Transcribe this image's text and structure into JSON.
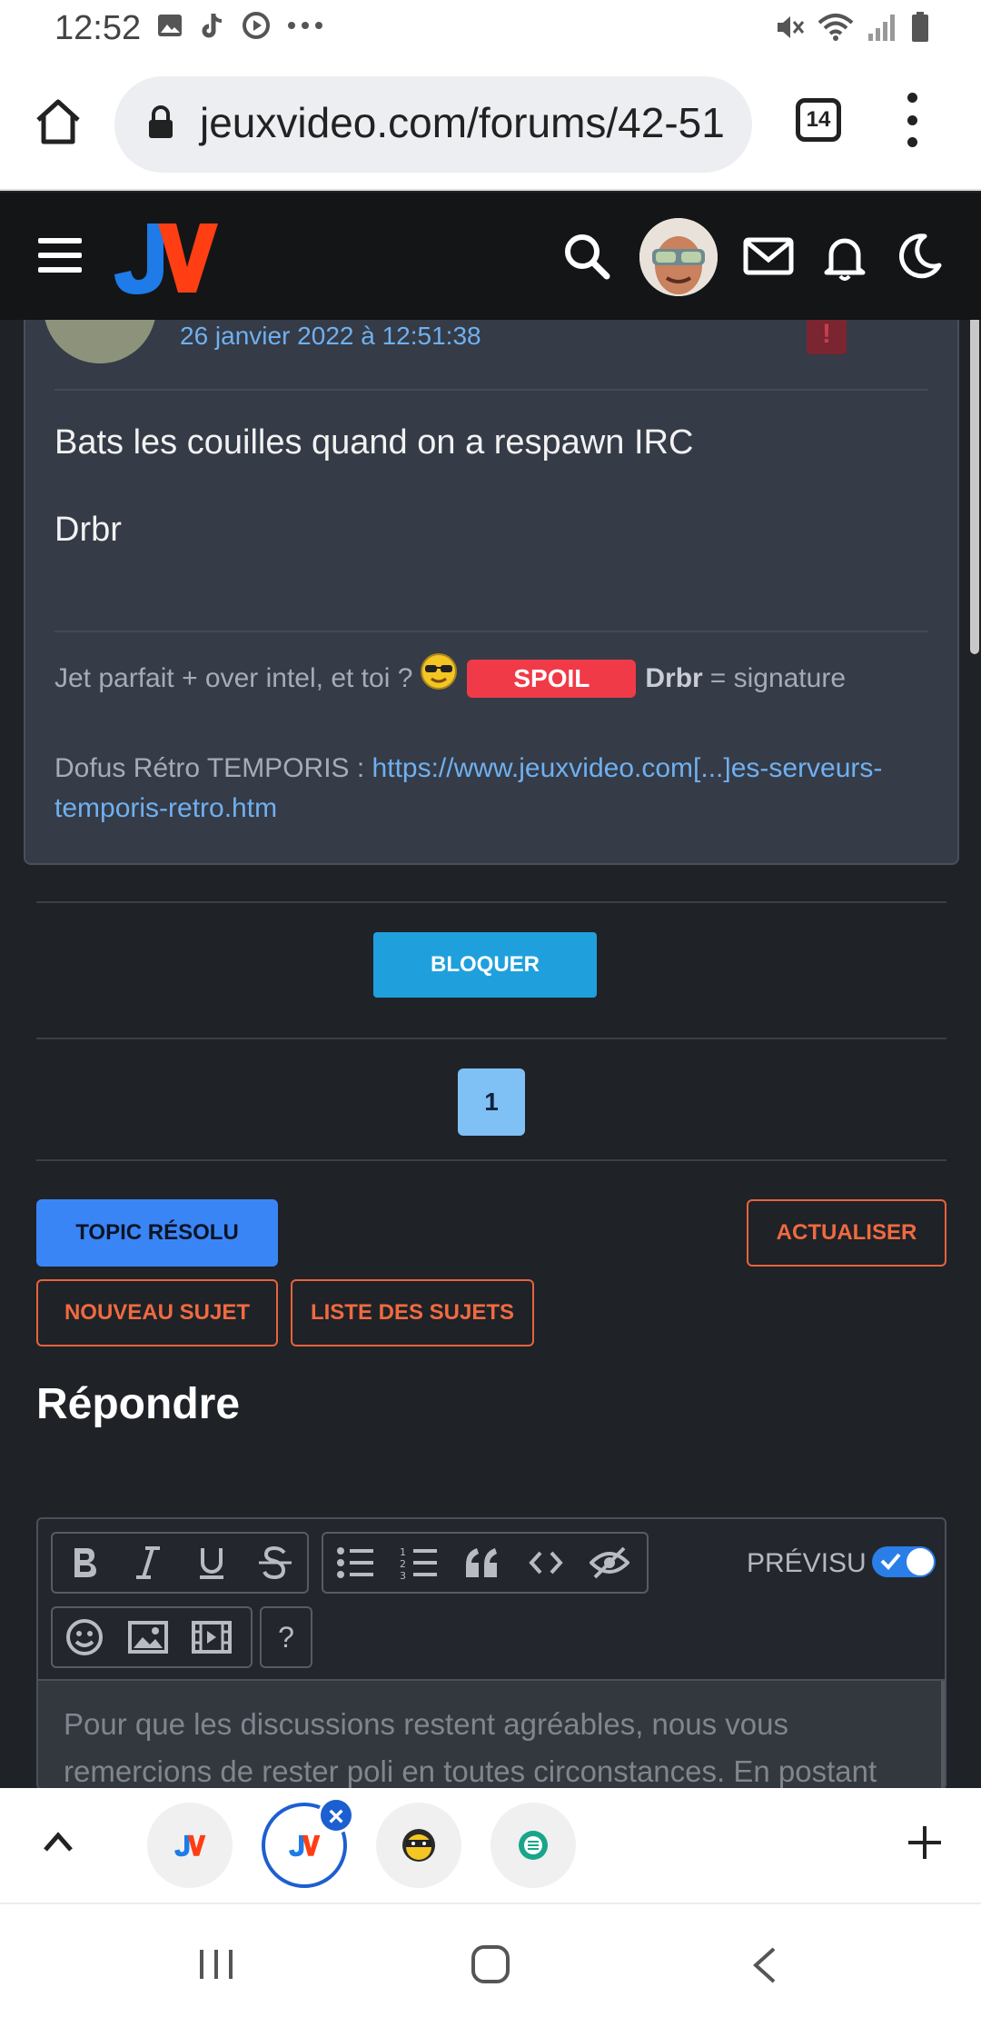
{
  "status_bar": {
    "time": "12:52"
  },
  "browser": {
    "url": "jeuxvideo.com/forums/42-51",
    "tab_count": "14"
  },
  "post": {
    "date": "26 janvier 2022 à 12:51:38",
    "alert_label": "!",
    "message_line1": "Bats les couilles quand on a respawn IRC",
    "message_line2": "Drbr",
    "signature": {
      "prefix": "Jet parfait + over intel, et toi ?",
      "spoil": "SPOIL",
      "bold": "Drbr",
      "suffix": "= signature",
      "line2_text": "Dofus Rétro TEMPORIS : ",
      "line2_link": "https://www.jeuxvideo.com[...]es-serveurs-temporis-retro.htm"
    }
  },
  "actions": {
    "bloquer": "BLOQUER",
    "page": "1",
    "topic_resolu": "TOPIC RÉSOLU",
    "actualiser": "ACTUALISER",
    "nouveau_sujet": "NOUVEAU SUJET",
    "liste_sujets": "LISTE DES SUJETS"
  },
  "reply": {
    "heading": "Répondre",
    "previsu": "PRÉVISU",
    "help": "?",
    "placeholder": "Pour que les discussions restent agréables, nous vous remercions de rester poli en toutes circonstances. En postant"
  },
  "colors": {
    "accent_blue": "#3a85f5",
    "accent_orange": "#f06a40",
    "spoil_red": "#f03a48",
    "link_blue": "#6fb0f0"
  }
}
